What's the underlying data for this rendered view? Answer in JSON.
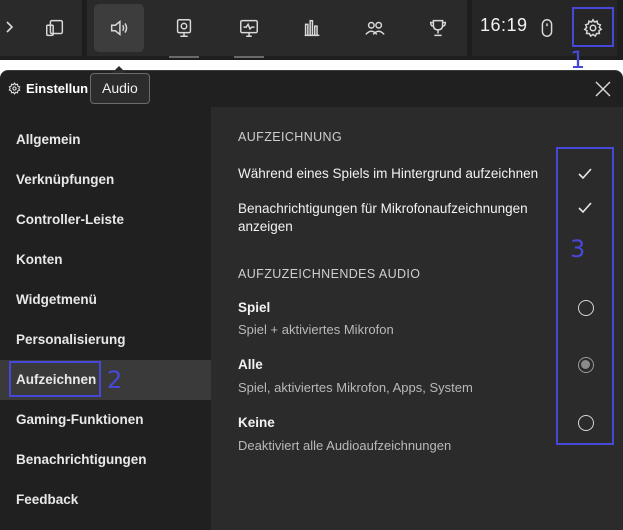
{
  "topbar": {
    "clock": "16:19",
    "tooltip": "Audio"
  },
  "window": {
    "title": "Einstellun"
  },
  "sidebar": {
    "items": [
      {
        "label": "Allgemein"
      },
      {
        "label": "Verknüpfungen"
      },
      {
        "label": "Controller-Leiste"
      },
      {
        "label": "Konten"
      },
      {
        "label": "Widgetmenü"
      },
      {
        "label": "Personalisierung"
      },
      {
        "label": "Aufzeichnen"
      },
      {
        "label": "Gaming-Funktionen"
      },
      {
        "label": "Benachrichtigungen"
      },
      {
        "label": "Feedback"
      }
    ],
    "selected_index": 6
  },
  "content": {
    "section1_title": "AUFZEICHNUNG",
    "checkbox_opts": [
      {
        "label": "Während eines Spiels im Hintergrund aufzeichnen",
        "checked": true
      },
      {
        "label": "Benachrichtigungen für Mikrofonaufzeichnungen anzeigen",
        "checked": true
      }
    ],
    "section2_title": "AUFZUZEICHNENDES AUDIO",
    "radio_opts": [
      {
        "title": "Spiel",
        "subtitle": "Spiel + aktiviertes Mikrofon",
        "selected": false
      },
      {
        "title": "Alle",
        "subtitle": "Spiel, aktiviertes Mikrofon, Apps, System",
        "selected": true
      },
      {
        "title": "Keine",
        "subtitle": "Deaktiviert alle Audioaufzeichnungen",
        "selected": false
      }
    ]
  },
  "annotations": {
    "a1": "1",
    "a2": "2",
    "a3": "3"
  },
  "colors": {
    "annotation": "#4848d8",
    "background": "#202020",
    "content_bg": "#2b2b2b"
  }
}
